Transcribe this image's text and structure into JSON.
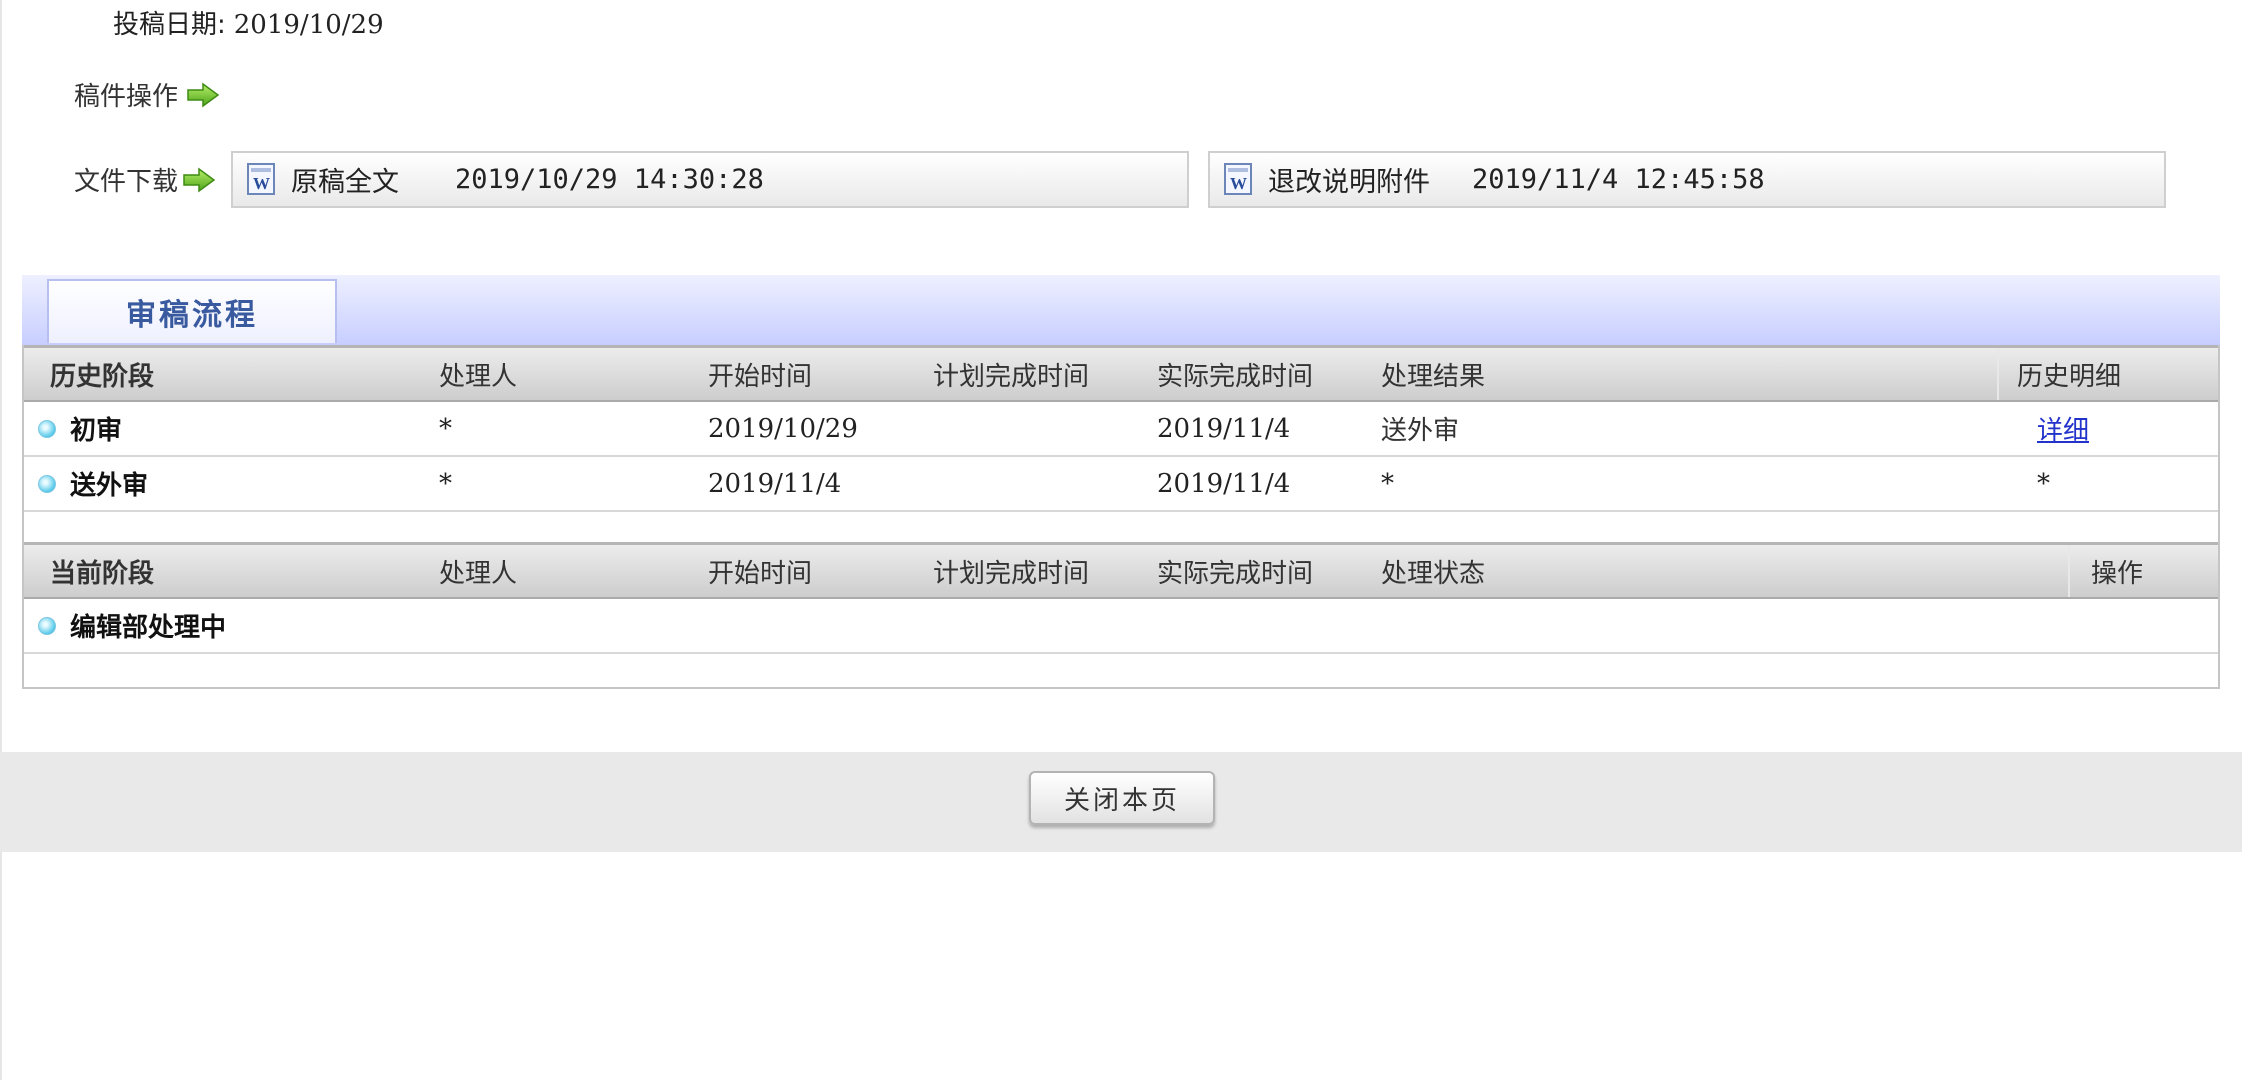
{
  "submission": {
    "date_label": "投稿日期:",
    "date_value": "2019/10/29"
  },
  "manuscript_ops": {
    "label": "稿件操作"
  },
  "file_download": {
    "label": "文件下载",
    "files": [
      {
        "name": "原稿全文",
        "time": "2019/10/29 14:30:28"
      },
      {
        "name": "退改说明附件",
        "time": "2019/11/4 12:45:58"
      }
    ]
  },
  "process": {
    "tab_label": "审稿流程"
  },
  "history": {
    "headers": [
      "历史阶段",
      "处理人",
      "开始时间",
      "计划完成时间",
      "实际完成时间",
      "处理结果",
      "历史明细"
    ],
    "rows": [
      {
        "stage": "初审",
        "handler": "*",
        "start": "2019/10/29",
        "planned": "",
        "actual": "2019/11/4",
        "result": "送外审",
        "detail": "详细"
      },
      {
        "stage": "送外审",
        "handler": "*",
        "start": "2019/11/4",
        "planned": "",
        "actual": "2019/11/4",
        "result": "*",
        "detail": "*"
      }
    ]
  },
  "current": {
    "headers": [
      "当前阶段",
      "处理人",
      "开始时间",
      "计划完成时间",
      "实际完成时间",
      "处理状态",
      "操作"
    ],
    "rows": [
      {
        "stage": "编辑部处理中"
      }
    ]
  },
  "footer": {
    "close_label": "关闭本页"
  }
}
